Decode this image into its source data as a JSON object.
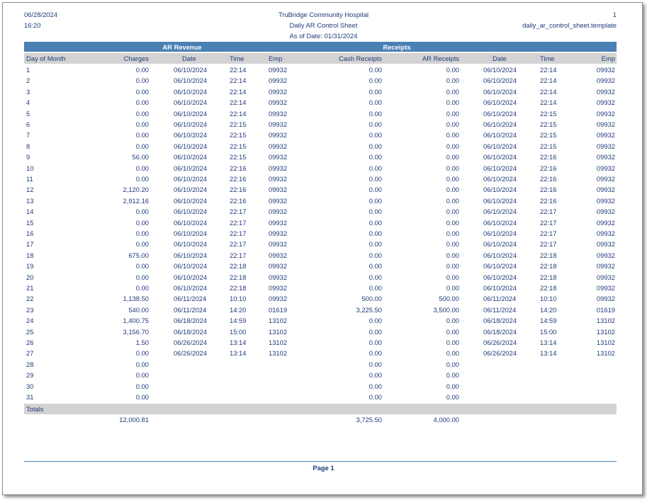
{
  "header": {
    "date": "06/28/2024",
    "time": "16:20",
    "hospital": "TruBridge Community Hospital",
    "report_title": "Daily AR Control Sheet",
    "as_of": "As of Date: 01/31/2024",
    "page_number": "1",
    "template": "daily_ar_control_sheet.template"
  },
  "groups": {
    "ar_revenue": "AR Revenue",
    "receipts": "Receipts"
  },
  "columns": {
    "day": "Day of Month",
    "charges": "Charges",
    "date1": "Date",
    "time1": "Time",
    "emp1": "Emp",
    "cash": "Cash Receipts",
    "ar": "AR Receipts",
    "date2": "Date",
    "time2": "Time",
    "emp2": "Emp"
  },
  "rows": [
    [
      "1",
      "0.00",
      "06/10/2024",
      "22:14",
      "09932",
      "0.00",
      "0.00",
      "06/10/2024",
      "22:14",
      "09932"
    ],
    [
      "2",
      "0.00",
      "06/10/2024",
      "22:14",
      "09932",
      "0.00",
      "0.00",
      "06/10/2024",
      "22:14",
      "09932"
    ],
    [
      "3",
      "0.00",
      "06/10/2024",
      "22:14",
      "09932",
      "0.00",
      "0.00",
      "06/10/2024",
      "22:14",
      "09932"
    ],
    [
      "4",
      "0.00",
      "06/10/2024",
      "22:14",
      "09932",
      "0.00",
      "0.00",
      "06/10/2024",
      "22:14",
      "09932"
    ],
    [
      "5",
      "0.00",
      "06/10/2024",
      "22:14",
      "09932",
      "0.00",
      "0.00",
      "06/10/2024",
      "22:15",
      "09932"
    ],
    [
      "6",
      "0.00",
      "06/10/2024",
      "22:15",
      "09932",
      "0.00",
      "0.00",
      "06/10/2024",
      "22:15",
      "09932"
    ],
    [
      "7",
      "0.00",
      "06/10/2024",
      "22:15",
      "09932",
      "0.00",
      "0.00",
      "06/10/2024",
      "22:15",
      "09932"
    ],
    [
      "8",
      "0.00",
      "06/10/2024",
      "22:15",
      "09932",
      "0.00",
      "0.00",
      "06/10/2024",
      "22:15",
      "09932"
    ],
    [
      "9",
      "56.00",
      "06/10/2024",
      "22:15",
      "09932",
      "0.00",
      "0.00",
      "06/10/2024",
      "22:16",
      "09932"
    ],
    [
      "10",
      "0.00",
      "06/10/2024",
      "22:16",
      "09932",
      "0.00",
      "0.00",
      "06/10/2024",
      "22:16",
      "09932"
    ],
    [
      "11",
      "0.00",
      "06/10/2024",
      "22:16",
      "09932",
      "0.00",
      "0.00",
      "06/10/2024",
      "22:16",
      "09932"
    ],
    [
      "12",
      "2,120.20",
      "06/10/2024",
      "22:16",
      "09932",
      "0.00",
      "0.00",
      "06/10/2024",
      "22:16",
      "09932"
    ],
    [
      "13",
      "2,912.16",
      "06/10/2024",
      "22:16",
      "09932",
      "0.00",
      "0.00",
      "06/10/2024",
      "22:16",
      "09932"
    ],
    [
      "14",
      "0.00",
      "06/10/2024",
      "22:17",
      "09932",
      "0.00",
      "0.00",
      "06/10/2024",
      "22:17",
      "09932"
    ],
    [
      "15",
      "0.00",
      "06/10/2024",
      "22:17",
      "09932",
      "0.00",
      "0.00",
      "06/10/2024",
      "22:17",
      "09932"
    ],
    [
      "16",
      "0.00",
      "06/10/2024",
      "22:17",
      "09932",
      "0.00",
      "0.00",
      "06/10/2024",
      "22:17",
      "09932"
    ],
    [
      "17",
      "0.00",
      "06/10/2024",
      "22:17",
      "09932",
      "0.00",
      "0.00",
      "06/10/2024",
      "22:17",
      "09932"
    ],
    [
      "18",
      "675.00",
      "06/10/2024",
      "22:17",
      "09932",
      "0.00",
      "0.00",
      "06/10/2024",
      "22:18",
      "09932"
    ],
    [
      "19",
      "0.00",
      "06/10/2024",
      "22:18",
      "09932",
      "0.00",
      "0.00",
      "06/10/2024",
      "22:18",
      "09932"
    ],
    [
      "20",
      "0.00",
      "06/10/2024",
      "22:18",
      "09932",
      "0.00",
      "0.00",
      "06/10/2024",
      "22:18",
      "09932"
    ],
    [
      "21",
      "0.00",
      "06/10/2024",
      "22:18",
      "09932",
      "0.00",
      "0.00",
      "06/10/2024",
      "22:18",
      "09932"
    ],
    [
      "22",
      "1,138.50",
      "06/11/2024",
      "10:10",
      "09932",
      "500.00",
      "500.00",
      "06/11/2024",
      "10:10",
      "09932"
    ],
    [
      "23",
      "540.00",
      "06/11/2024",
      "14:20",
      "01619",
      "3,225.50",
      "3,500.00",
      "06/11/2024",
      "14:20",
      "01619"
    ],
    [
      "24",
      "1,400.75",
      "06/18/2024",
      "14:59",
      "13102",
      "0.00",
      "0.00",
      "06/18/2024",
      "14:59",
      "13102"
    ],
    [
      "25",
      "3,156.70",
      "06/18/2024",
      "15:00",
      "13102",
      "0.00",
      "0.00",
      "06/18/2024",
      "15:00",
      "13102"
    ],
    [
      "26",
      "1.50",
      "06/26/2024",
      "13:14",
      "13102",
      "0.00",
      "0.00",
      "06/26/2024",
      "13:14",
      "13102"
    ],
    [
      "27",
      "0.00",
      "06/26/2024",
      "13:14",
      "13102",
      "0.00",
      "0.00",
      "06/26/2024",
      "13:14",
      "13102"
    ],
    [
      "28",
      "0.00",
      "",
      "",
      "",
      "0.00",
      "0.00",
      "",
      "",
      ""
    ],
    [
      "29",
      "0.00",
      "",
      "",
      "",
      "0.00",
      "0.00",
      "",
      "",
      ""
    ],
    [
      "30",
      "0.00",
      "",
      "",
      "",
      "0.00",
      "0.00",
      "",
      "",
      ""
    ],
    [
      "31",
      "0.00",
      "",
      "",
      "",
      "0.00",
      "0.00",
      "",
      "",
      ""
    ]
  ],
  "totals": {
    "label": "Totals",
    "charges": "12,000.81",
    "cash": "3,725.50",
    "ar": "4,000.00"
  },
  "footer": {
    "page": "Page 1"
  }
}
